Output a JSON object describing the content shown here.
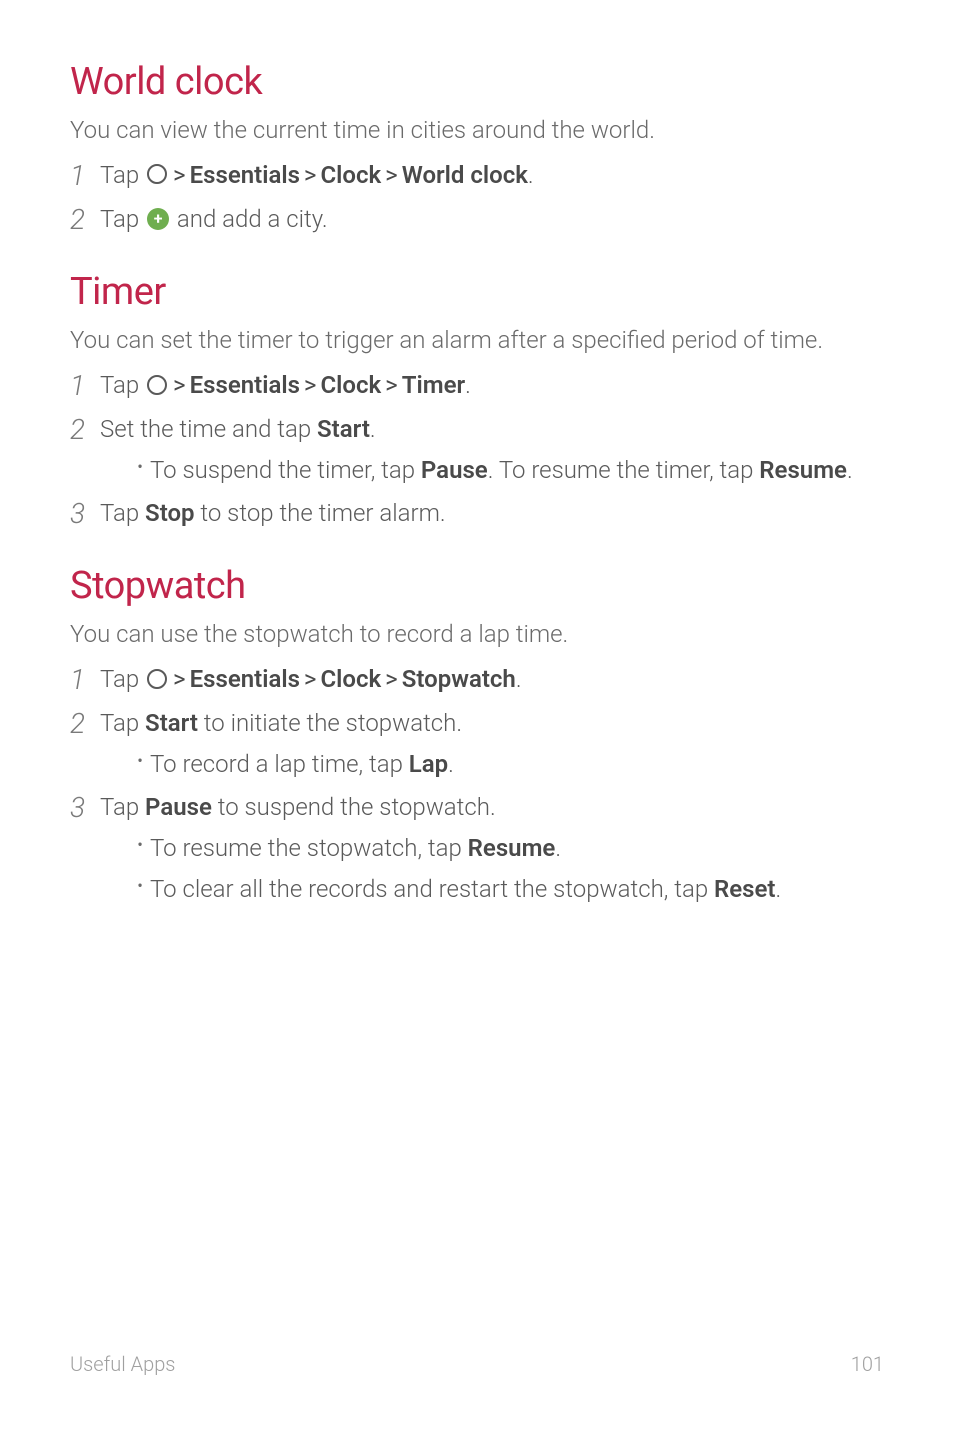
{
  "sections": {
    "world_clock": {
      "heading": "World clock",
      "intro": "You can view the current time in cities around the world.",
      "steps": {
        "s1": {
          "num": "1",
          "tap": "Tap ",
          "essentials": "Essentials",
          "clock": "Clock",
          "target": "World clock",
          "period": "."
        },
        "s2": {
          "num": "2",
          "tap_pre": "Tap ",
          "tap_post": " and add a city."
        }
      }
    },
    "timer": {
      "heading": "Timer",
      "intro": "You can set the timer to trigger an alarm after a specified period of time.",
      "steps": {
        "s1": {
          "num": "1",
          "tap": "Tap ",
          "essentials": "Essentials",
          "clock": "Clock",
          "target": "Timer",
          "period": "."
        },
        "s2": {
          "num": "2",
          "pre": "Set the time and tap ",
          "start": "Start",
          "period": ".",
          "bullet_pre": "To suspend the timer, tap ",
          "pause": "Pause",
          "bullet_mid": ". To resume the timer, tap ",
          "resume": "Resume",
          "bullet_period": "."
        },
        "s3": {
          "num": "3",
          "pre": "Tap ",
          "stop": "Stop",
          "post": " to stop the timer alarm."
        }
      }
    },
    "stopwatch": {
      "heading": "Stopwatch",
      "intro": "You can use the stopwatch to record a lap time.",
      "steps": {
        "s1": {
          "num": "1",
          "tap": "Tap ",
          "essentials": "Essentials",
          "clock": "Clock",
          "target": "Stopwatch",
          "period": "."
        },
        "s2": {
          "num": "2",
          "pre": "Tap ",
          "start": "Start",
          "post": " to initiate the stopwatch.",
          "bullet_pre": "To record a lap time, tap ",
          "lap": "Lap",
          "bullet_period": "."
        },
        "s3": {
          "num": "3",
          "pre": "Tap ",
          "pause": "Pause",
          "post": " to suspend the stopwatch.",
          "b1_pre": "To resume the stopwatch, tap ",
          "resume": "Resume",
          "b1_period": ".",
          "b2_pre": "To clear all the records and restart the stopwatch, tap ",
          "reset": "Reset",
          "b2_period": "."
        }
      }
    }
  },
  "common": {
    "gt": ">",
    "bullet": "•",
    "plus": "+"
  },
  "footer": {
    "section": "Useful Apps",
    "page": "101"
  }
}
